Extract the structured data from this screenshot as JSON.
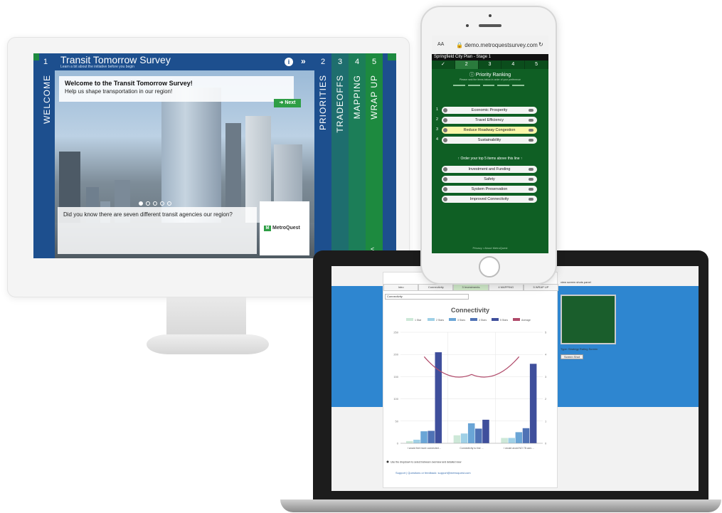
{
  "desktop": {
    "welcome_num": "1",
    "welcome_label": "WELCOME",
    "title": "Transit Tomorrow Survey",
    "subtitle": "Learn a bit about the initiative before you begin",
    "welcome_heading": "Welcome to the Transit Tomorrow Survey!",
    "welcome_text": "Help us shape transportation in our region!",
    "next_label": "Next",
    "fact_text": "Did you know there are seven different transit agencies our region?",
    "logo_text": "MetroQuest",
    "tabs": [
      {
        "num": "2",
        "label": "PRIORITIES",
        "color": "#1d4f8e"
      },
      {
        "num": "3",
        "label": "TRADEOFFS",
        "color": "#1e6e6e"
      },
      {
        "num": "4",
        "label": "MAPPING",
        "color": "#1c7e58"
      },
      {
        "num": "5",
        "label": "WRAP UP",
        "color": "#1d8a3f"
      }
    ],
    "colors": {
      "primary_blue": "#1d4f8e",
      "accent_green": "#2e9e45"
    }
  },
  "phone": {
    "aa": "AA",
    "url": "demo.metroquestsurvey.com",
    "stage": "Springfield City Plan - Stage 1",
    "tabs": [
      "✓",
      "2",
      "3",
      "4",
      "5"
    ],
    "heading": "Priority Ranking",
    "hint": "Please rank the items below in order of your preference",
    "top_items": [
      {
        "num": "1",
        "label": "Economic Prosperity"
      },
      {
        "num": "2",
        "label": "Travel Efficiency"
      },
      {
        "num": "3",
        "label": "Reduce Roadway Congestion"
      },
      {
        "num": "4",
        "label": "Sustainability"
      }
    ],
    "order_text": "Order your top 5 items above this line",
    "other_items": [
      "Investment and Funding",
      "Safety",
      "System Preservation",
      "Improved Connectivity"
    ],
    "footer": "Privacy • About MetroQuest"
  },
  "laptop": {
    "tabs": [
      "Intro",
      "Connectivity",
      "3 Investments",
      "4 MAPPING",
      "5 WRAP UP"
    ],
    "select_value": "Connectivity",
    "side_link": "view screen shots panel",
    "side_caption": "Type: Strategy Rating Screen",
    "side_button": "Screen Shot",
    "footer": "Support  |  Questions or feedback: support@metroquest.com"
  },
  "chart_data": {
    "type": "bar",
    "title": "Connectivity",
    "series": [
      {
        "name": "1 Star",
        "color": "#cde8d8",
        "values": [
          5,
          18,
          12
        ]
      },
      {
        "name": "2 Stars",
        "color": "#9fd0e6",
        "values": [
          8,
          22,
          12
        ]
      },
      {
        "name": "3 Stars",
        "color": "#6aa5d6",
        "values": [
          27,
          45,
          25
        ]
      },
      {
        "name": "4 Stars",
        "color": "#4f72b5",
        "values": [
          28,
          33,
          34
        ]
      },
      {
        "name": "5 Stars",
        "color": "#3f4f9c",
        "values": [
          205,
          53,
          179
        ]
      }
    ],
    "line_series": {
      "name": "Average",
      "color": "#b04a6a",
      "values": [
        3.9,
        3.1,
        3.9
      ],
      "axis": "right"
    },
    "categories": [
      "I would feel more connected...",
      "Connectivity to line ...",
      "I would avoid NO 78 cars ..."
    ],
    "ylim": [
      0,
      250
    ],
    "y_ticks": [
      "0",
      "50",
      "100",
      "150",
      "200",
      "250"
    ],
    "y2lim": [
      0,
      5
    ],
    "y2_ticks": [
      "0",
      "1",
      "2",
      "3",
      "4",
      "5"
    ],
    "note": "Use the dropdown to select between overview and detailed view"
  }
}
